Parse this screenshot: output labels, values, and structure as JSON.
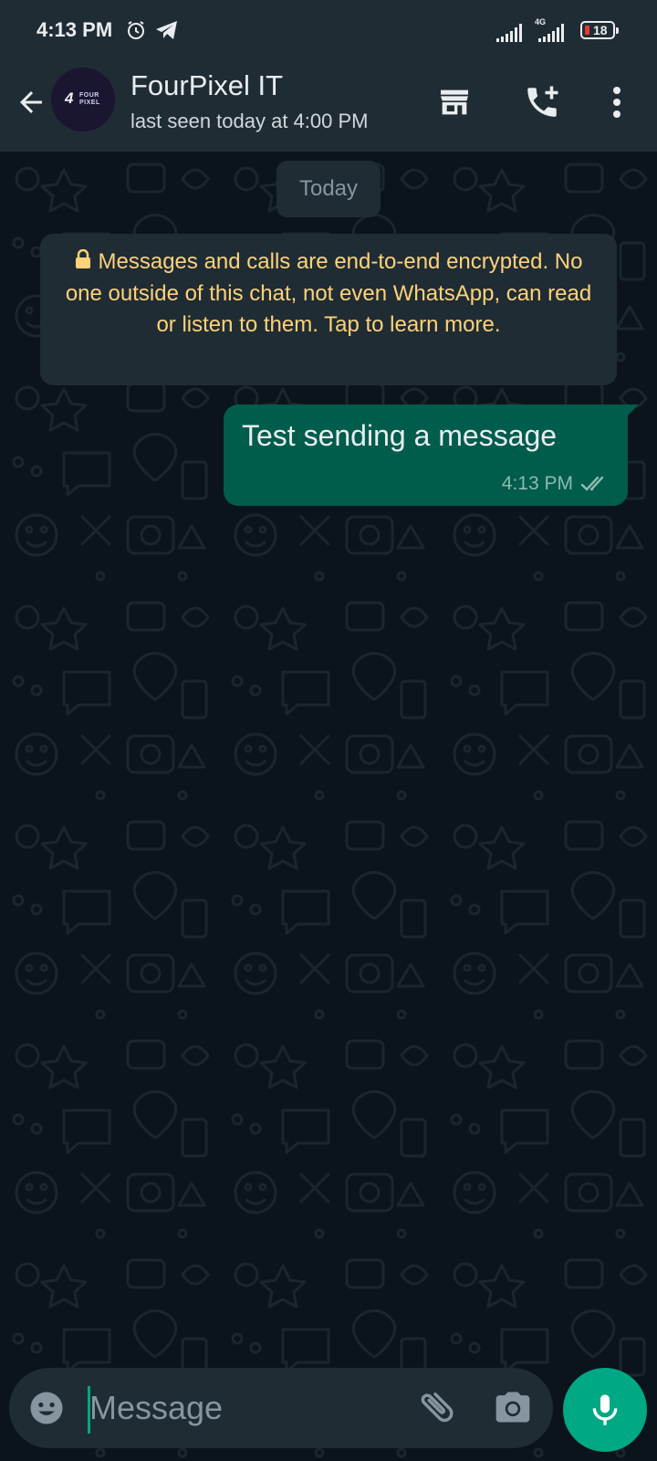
{
  "status_bar": {
    "time": "4:13 PM",
    "network": "4G",
    "battery_level": "18",
    "icons": [
      "alarm-icon",
      "telegram-icon",
      "signal-icon",
      "battery-icon"
    ]
  },
  "header": {
    "contact_name": "FourPixel IT",
    "contact_status": "last seen today at 4:00 PM",
    "avatar": {
      "number": "4",
      "line1": "FOUR",
      "line2": "PIXEL",
      "background": "#1a1530"
    },
    "icons": [
      "back-arrow-icon",
      "storefront-icon",
      "add-call-icon",
      "more-vertical-icon"
    ]
  },
  "chat": {
    "date_label": "Today",
    "encryption_notice": "Messages and calls are end-to-end encrypted. No one outside of this chat, not even WhatsApp, can read or listen to them. Tap to learn more.",
    "messages": [
      {
        "direction": "outgoing",
        "text": "Test sending a message",
        "time": "4:13 PM",
        "status": "read"
      }
    ]
  },
  "input": {
    "placeholder": "Message",
    "value": "",
    "icons": [
      "emoji-icon",
      "paperclip-icon",
      "camera-icon",
      "microphone-icon"
    ]
  },
  "colors": {
    "background": "#0b141a",
    "panel": "#1f2c34",
    "outgoing_bubble": "#005c4b",
    "accent": "#00a884",
    "notice_text": "#ffd279",
    "secondary_text": "#8696a0"
  }
}
